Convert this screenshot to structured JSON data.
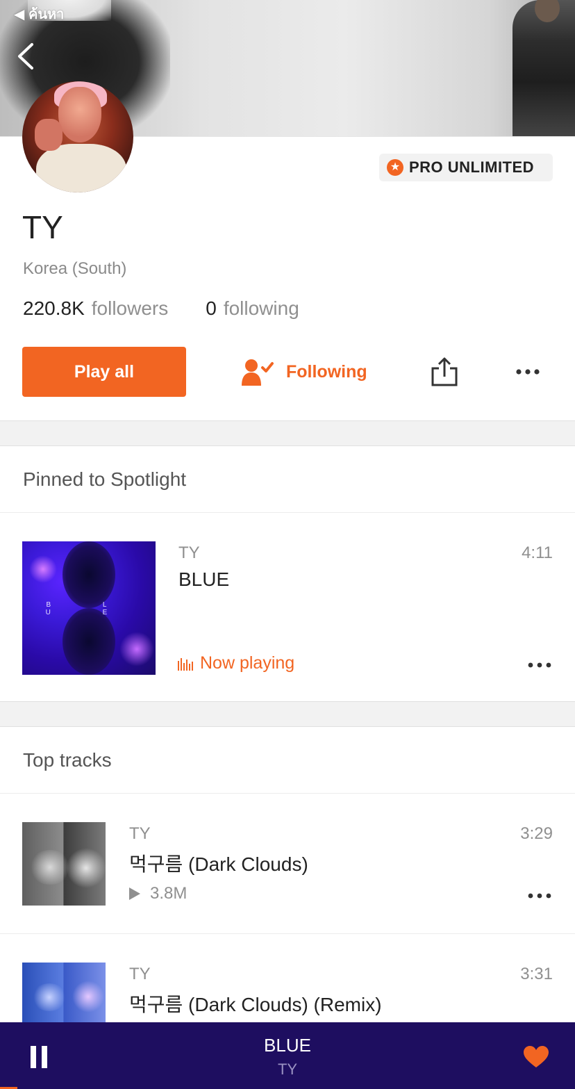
{
  "status": {
    "back_app": "◀ ค้นหา"
  },
  "profile": {
    "badge": "PRO UNLIMITED",
    "name": "TY",
    "location": "Korea (South)",
    "followers_count": "220.8K",
    "followers_label": "followers",
    "following_count": "0",
    "following_label": "following"
  },
  "actions": {
    "play_all": "Play all",
    "follow_state": "Following"
  },
  "spotlight": {
    "title": "Pinned to Spotlight",
    "track": {
      "artist": "TY",
      "title": "BLUE",
      "duration": "4:11",
      "status": "Now playing",
      "art_letters": "B L U E"
    }
  },
  "top_tracks": {
    "title": "Top tracks",
    "items": [
      {
        "artist": "TY",
        "title": "먹구름 (Dark Clouds)",
        "duration": "3:29",
        "plays": "3.8M"
      },
      {
        "artist": "TY",
        "title": "먹구름 (Dark Clouds) (Remix)",
        "duration": "3:31"
      }
    ]
  },
  "player": {
    "title": "BLUE",
    "artist": "TY",
    "progress": 0.03
  },
  "colors": {
    "accent": "#f26522",
    "player_bg": "#1e0e60"
  },
  "icons": [
    "back-chevron-icon",
    "star-icon",
    "user-check-icon",
    "share-icon",
    "more-icon",
    "equalizer-icon",
    "play-icon",
    "pause-icon",
    "heart-icon"
  ]
}
